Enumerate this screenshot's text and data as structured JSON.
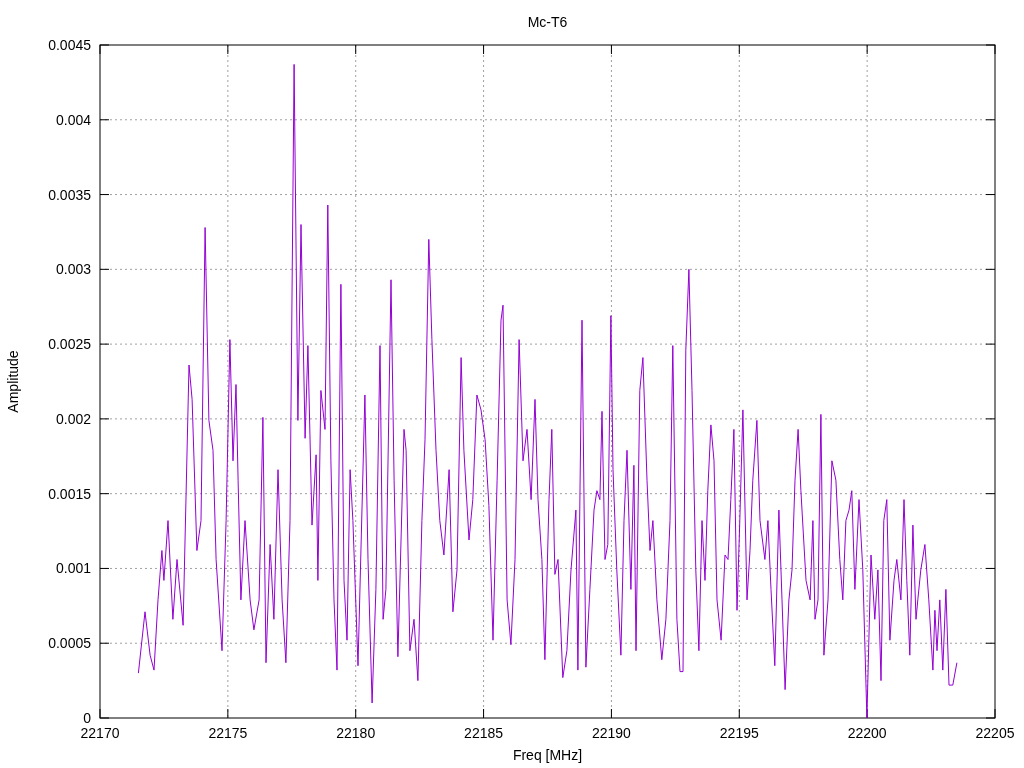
{
  "chart_data": {
    "type": "line",
    "title": "Mc-T6",
    "xlabel": "Freq [MHz]",
    "ylabel": "Amplitude",
    "grid": true,
    "xlim": [
      22170,
      22205
    ],
    "ylim": [
      0,
      0.0045
    ],
    "xticks": [
      22170,
      22175,
      22180,
      22185,
      22190,
      22195,
      22200,
      22205
    ],
    "yticks": [
      0,
      0.0005,
      0.001,
      0.0015,
      0.002,
      0.0025,
      0.003,
      0.0035,
      0.004,
      0.0045
    ],
    "x": [
      22171.5,
      22171.76,
      22171.96,
      22172.11,
      22172.27,
      22172.42,
      22172.5,
      22172.66,
      22172.85,
      22173.01,
      22173.25,
      22173.48,
      22173.6,
      22173.79,
      22173.95,
      22174.11,
      22174.26,
      22174.42,
      22174.54,
      22174.77,
      22174.93,
      22175.08,
      22175.2,
      22175.32,
      22175.4,
      22175.51,
      22175.67,
      22175.87,
      22176.02,
      22176.22,
      22176.37,
      22176.49,
      22176.65,
      22176.8,
      22176.96,
      22177.12,
      22177.27,
      22177.43,
      22177.59,
      22177.74,
      22177.86,
      22178.02,
      22178.13,
      22178.29,
      22178.45,
      22178.52,
      22178.64,
      22178.8,
      22178.91,
      22179.03,
      22179.15,
      22179.27,
      22179.42,
      22179.54,
      22179.66,
      22179.78,
      22179.89,
      22180.09,
      22180.36,
      22180.48,
      22180.64,
      22180.79,
      22180.95,
      22181.07,
      22181.18,
      22181.38,
      22181.5,
      22181.65,
      22181.89,
      22181.97,
      22182.12,
      22182.28,
      22182.43,
      22182.59,
      22182.71,
      22182.86,
      22182.98,
      22183.14,
      22183.29,
      22183.45,
      22183.65,
      22183.8,
      22183.96,
      22184.12,
      22184.23,
      22184.43,
      22184.58,
      22184.74,
      22184.9,
      22185.06,
      22185.21,
      22185.37,
      22185.53,
      22185.68,
      22185.76,
      22185.92,
      22186.07,
      22186.23,
      22186.39,
      22186.54,
      22186.7,
      22186.86,
      22187.01,
      22187.13,
      22187.28,
      22187.4,
      22187.56,
      22187.67,
      22187.79,
      22187.91,
      22188.1,
      22188.26,
      22188.42,
      22188.61,
      22188.69,
      22188.85,
      22189,
      22189.16,
      22189.32,
      22189.43,
      22189.55,
      22189.63,
      22189.75,
      22189.86,
      22189.98,
      22190.06,
      22190.21,
      22190.37,
      22190.49,
      22190.61,
      22190.76,
      22190.88,
      22190.96,
      22191.11,
      22191.23,
      22191.39,
      22191.51,
      22191.62,
      22191.78,
      22191.97,
      22192.13,
      22192.29,
      22192.4,
      22192.56,
      22192.68,
      22192.8,
      22192.91,
      22193.03,
      22193.15,
      22193.3,
      22193.42,
      22193.54,
      22193.66,
      22193.77,
      22193.89,
      22194.01,
      22194.13,
      22194.29,
      22194.44,
      22194.56,
      22194.67,
      22194.79,
      22194.91,
      22195.02,
      22195.14,
      22195.3,
      22195.42,
      22195.53,
      22195.69,
      22195.81,
      22196,
      22196.12,
      22196.24,
      22196.39,
      22196.55,
      22196.67,
      22196.79,
      22196.94,
      22197.06,
      22197.18,
      22197.3,
      22197.41,
      22197.61,
      22197.77,
      22197.88,
      22197.96,
      22198.08,
      22198.19,
      22198.31,
      22198.47,
      22198.62,
      22198.78,
      22198.93,
      22199.05,
      22199.17,
      22199.29,
      22199.4,
      22199.52,
      22199.68,
      22199.83,
      22199.99,
      22200.15,
      22200.3,
      22200.42,
      22200.54,
      22200.65,
      22200.77,
      22200.89,
      22201.05,
      22201.16,
      22201.32,
      22201.44,
      22201.55,
      22201.67,
      22201.79,
      22201.91,
      22201.98,
      22202.1,
      22202.26,
      22202.41,
      22202.57,
      22202.65,
      22202.73,
      22202.84,
      22202.96,
      22203.08,
      22203.2,
      22203.35,
      22203.51
    ],
    "series": [
      {
        "color": "#9400d3",
        "values": [
          0.0003,
          0.00071,
          0.00042,
          0.00032,
          0.00079,
          0.00112,
          0.00092,
          0.00132,
          0.00066,
          0.00106,
          0.00062,
          0.00236,
          0.00213,
          0.00112,
          0.00132,
          0.00328,
          0.00199,
          0.00179,
          0.00106,
          0.00045,
          0.00132,
          0.00253,
          0.00172,
          0.00223,
          0.00159,
          0.00079,
          0.00132,
          0.00079,
          0.00059,
          0.00079,
          0.00201,
          0.00037,
          0.00116,
          0.00066,
          0.00166,
          0.00079,
          0.00037,
          0.00132,
          0.00437,
          0.00199,
          0.0033,
          0.00187,
          0.00249,
          0.00129,
          0.00176,
          0.00092,
          0.00219,
          0.00193,
          0.00343,
          0.00172,
          0.00079,
          0.00032,
          0.0029,
          0.00092,
          0.00052,
          0.00166,
          0.00132,
          0.00035,
          0.00216,
          0.00106,
          0.0001,
          0.00086,
          0.00249,
          0.00066,
          0.00086,
          0.00293,
          0.00159,
          0.00041,
          0.00193,
          0.00179,
          0.00045,
          0.00066,
          0.00025,
          0.00132,
          0.00186,
          0.0032,
          0.00253,
          0.00179,
          0.00132,
          0.00109,
          0.00166,
          0.00071,
          0.00099,
          0.00241,
          0.00179,
          0.00119,
          0.00146,
          0.00216,
          0.00206,
          0.00186,
          0.00142,
          0.00052,
          0.00159,
          0.00266,
          0.00276,
          0.00079,
          0.00049,
          0.00106,
          0.00253,
          0.00172,
          0.00193,
          0.00146,
          0.00213,
          0.00146,
          0.00106,
          0.00039,
          0.00146,
          0.00193,
          0.00096,
          0.00106,
          0.00027,
          0.00045,
          0.00099,
          0.00139,
          0.00032,
          0.00266,
          0.00034,
          0.00086,
          0.00139,
          0.00152,
          0.00146,
          0.00205,
          0.00106,
          0.00116,
          0.00269,
          0.00166,
          0.00099,
          0.00042,
          0.00132,
          0.00179,
          0.00086,
          0.00169,
          0.00045,
          0.00219,
          0.00241,
          0.00159,
          0.00112,
          0.00132,
          0.00079,
          0.00039,
          0.00066,
          0.00132,
          0.00249,
          0.00066,
          0.00031,
          0.00031,
          0.00246,
          0.003,
          0.00219,
          0.00099,
          0.00045,
          0.00132,
          0.00092,
          0.00152,
          0.00196,
          0.00172,
          0.00079,
          0.00052,
          0.00109,
          0.00106,
          0.00146,
          0.00193,
          0.00072,
          0.00132,
          0.00206,
          0.00079,
          0.00112,
          0.00159,
          0.00199,
          0.00132,
          0.00106,
          0.00132,
          0.00086,
          0.00035,
          0.00139,
          0.00079,
          0.00019,
          0.00079,
          0.00099,
          0.00159,
          0.00193,
          0.00152,
          0.00092,
          0.00079,
          0.00132,
          0.00066,
          0.00079,
          0.00203,
          0.00042,
          0.00079,
          0.00172,
          0.00159,
          0.00106,
          0.00079,
          0.00132,
          0.00139,
          0.00152,
          0.00086,
          0.00146,
          0.00099,
          0,
          0.00109,
          0.00066,
          0.00099,
          0.00025,
          0.00132,
          0.00146,
          0.00052,
          0.00092,
          0.00106,
          0.00079,
          0.00146,
          0.00092,
          0.00042,
          0.00129,
          0.00066,
          0.00079,
          0.00099,
          0.00116,
          0.00079,
          0.00032,
          0.00072,
          0.00045,
          0.00079,
          0.00032,
          0.00086,
          0.00022,
          0.00022,
          0.00037
        ]
      }
    ]
  }
}
